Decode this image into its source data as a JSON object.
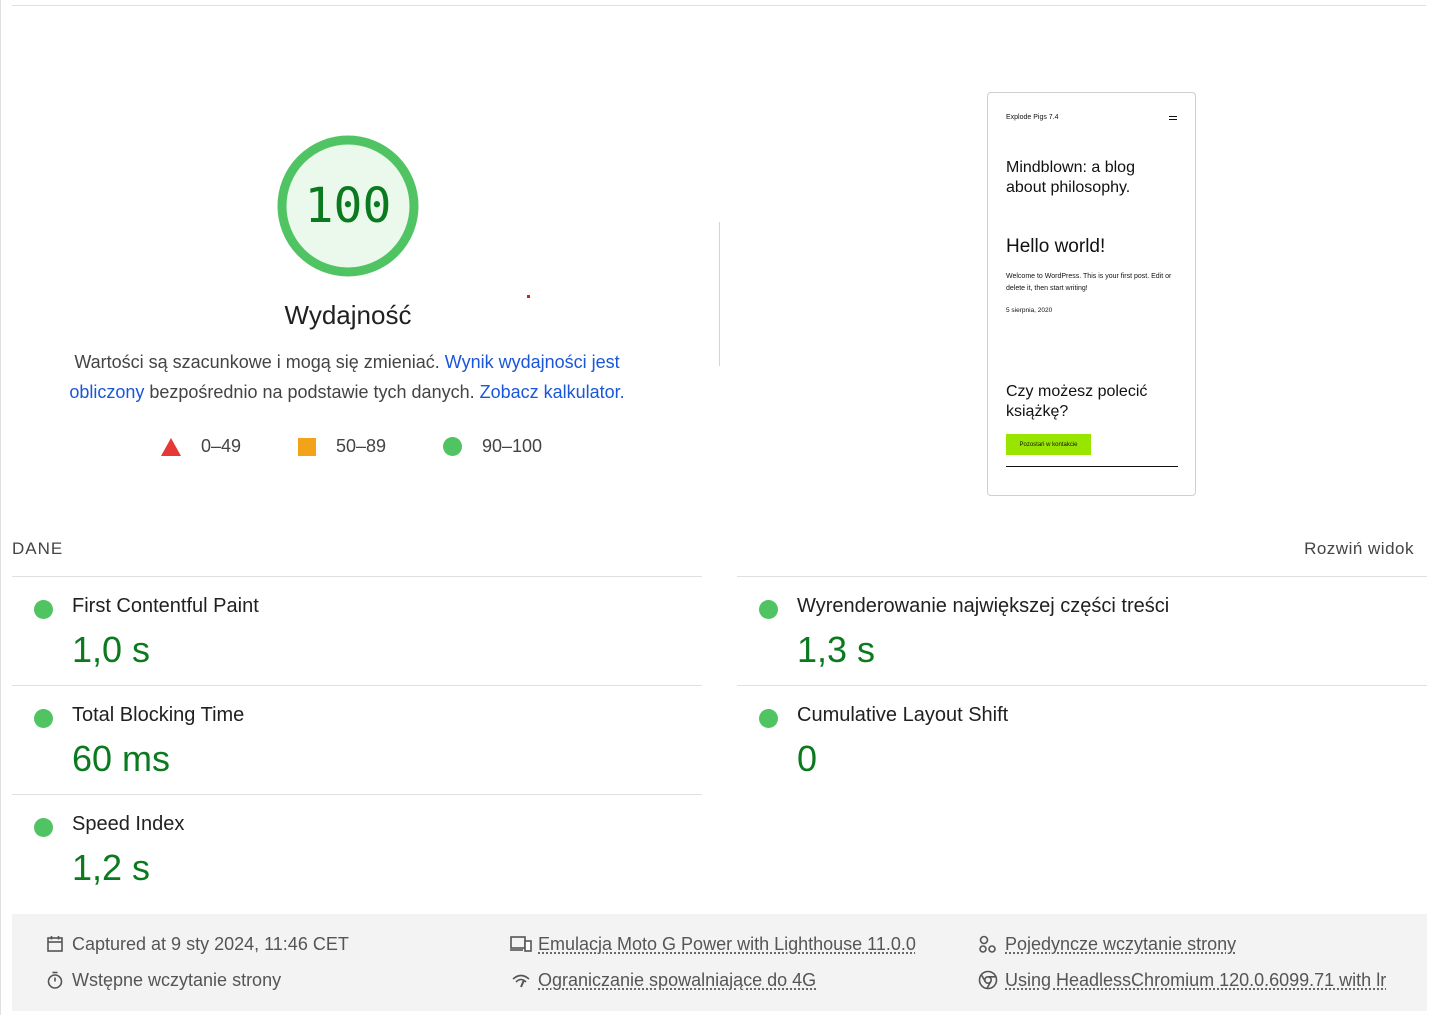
{
  "score": {
    "value": "100",
    "fraction": 1.0,
    "title": "Wydajność",
    "color": "#0b7a1f",
    "ring_color": "#50c463",
    "fill_color": "#eaf9ec"
  },
  "note": {
    "text_1": "Wartości są szacunkowe i mogą się zmieniać. ",
    "link_1": "Wynik wydajności jest obliczony",
    "text_2": " bezpośrednio na podstawie tych danych. ",
    "link_2": "Zobacz kalkulator."
  },
  "legend": [
    {
      "shape": "triangle",
      "label": "0–49",
      "color": "#e53935"
    },
    {
      "shape": "square",
      "label": "50–89",
      "color": "#f3a31a"
    },
    {
      "shape": "circle",
      "label": "90–100",
      "color": "#50c463"
    }
  ],
  "screenshot": {
    "site_title": "Explode Pigs 7.4",
    "menu_icon": "hamburger-icon",
    "tagline": "Mindblown: a blog about philosophy.",
    "post_title": "Hello world!",
    "post_body": "Welcome to WordPress. This is your first post. Edit or delete it, then start writing!",
    "post_date": "5 sierpnia, 2020",
    "cta_heading": "Czy możesz polecić książkę?",
    "cta_button": "Pozostań w kontakcie",
    "cta_button_color": "#98e600"
  },
  "metrics": {
    "label": "DANE",
    "expand_label": "Rozwiń widok",
    "items": [
      {
        "name": "First Contentful Paint",
        "value": "1,0 s",
        "status": "good"
      },
      {
        "name": "Wyrenderowanie największej części treści",
        "value": "1,3 s",
        "status": "good"
      },
      {
        "name": "Total Blocking Time",
        "value": "60 ms",
        "status": "good"
      },
      {
        "name": "Cumulative Layout Shift",
        "value": "0",
        "status": "good"
      },
      {
        "name": "Speed Index",
        "value": "1,2 s",
        "status": "good"
      }
    ]
  },
  "footer": {
    "captured": {
      "icon": "calendar-icon",
      "text": "Captured at 9 sty 2024, 11:46 CET"
    },
    "emulation": {
      "icon": "devices-icon",
      "text": "Emulacja Moto G Power with Lighthouse 11.0.0"
    },
    "single_load": {
      "icon": "people-icon",
      "text": "Pojedyncze wczytanie strony"
    },
    "initial_load": {
      "icon": "stopwatch-icon",
      "text": "Wstępne wczytanie strony"
    },
    "throttling": {
      "icon": "signal-icon",
      "text": "Ograniczanie spowalniające do 4G"
    },
    "browser": {
      "icon": "chrome-icon",
      "text": "Using HeadlessChromium 120.0.6099.71 with lr"
    }
  }
}
